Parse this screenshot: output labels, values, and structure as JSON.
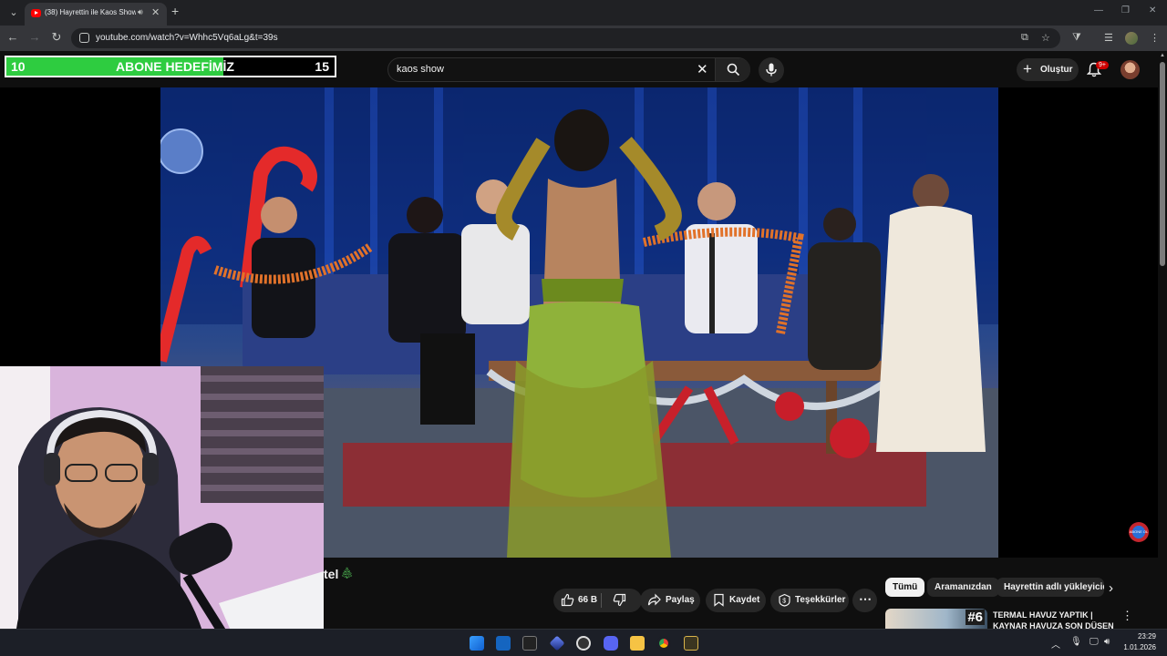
{
  "browser": {
    "tab_title": "(38) Hayrettin ile Kaos Show",
    "url": "youtube.com/watch?v=Whhc5Vq6aLg&t=39s"
  },
  "overlay": {
    "sub_goal_start": "10",
    "sub_goal_label": "ABONE HEDEFİMİZ",
    "sub_goal_end": "15",
    "sub_goal_progress": 0.66,
    "channel_watermark": "ABONE OL"
  },
  "youtube": {
    "search_value": "kaos show",
    "create_label": "Oluştur",
    "notification_badge": "9+",
    "video_title_visible": "tel",
    "likes": "66 B",
    "share_label": "Paylaş",
    "save_label": "Kaydet",
    "thanks_label": "Teşekkürler",
    "chips": [
      "Tümü",
      "Aramanızdan",
      "Hayrettin adlı yükleyicid"
    ],
    "recommendation": {
      "badge": "#6",
      "title_line1": "TERMAL HAVUZ YAPTIK |",
      "title_line2": "KAYNAR HAVUZA SON DÜŞEN"
    }
  },
  "taskbar": {
    "time": "23:29",
    "date": "1.01.2026"
  },
  "colors": {
    "goal_fill": "#2ecc40",
    "youtube_red": "#ff0000",
    "background": "#0f0f0f"
  }
}
